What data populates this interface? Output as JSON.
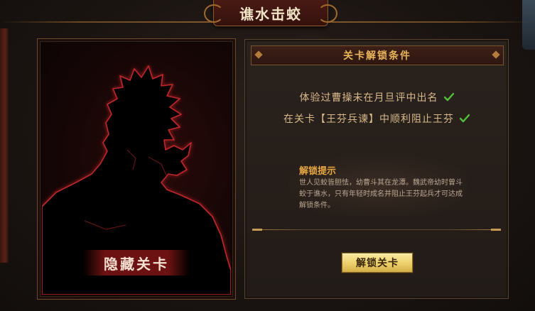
{
  "title": "谯水击蛟",
  "card": {
    "hidden_label": "隐藏关卡",
    "silhouette_icon": "character-silhouette"
  },
  "conditions_panel": {
    "header": "关卡解锁条件",
    "conditions": [
      {
        "text": "体验过曹操未在月旦评中出名",
        "met": true
      },
      {
        "text": "在关卡【王芬兵谏】中顺利阻止王芬",
        "met": true
      }
    ],
    "hint_title": "解锁提示",
    "hint_body": "世人见蛟皆胆怯，幼曹斗其在龙潭。魏武帝幼时曾斗蛟于谯水，只有年轻时成名并阻止王芬起兵才可达成解锁条件。",
    "unlock_button": "解锁关卡"
  },
  "colors": {
    "accent_gold": "#e8b45a",
    "check_green": "#52c23a",
    "silhouette_glow": "#c0282a"
  }
}
